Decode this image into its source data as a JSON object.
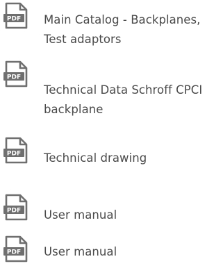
{
  "documents": [
    {
      "label": "Main Catalog - Backplanes, Test adaptors",
      "icon": "pdf-file-icon",
      "icon_text": "PDF"
    },
    {
      "label": "Technical Data Schroff CPCI backplane",
      "icon": "pdf-file-icon",
      "icon_text": "PDF"
    },
    {
      "label": "Technical drawing",
      "icon": "pdf-file-icon",
      "icon_text": "PDF"
    },
    {
      "label": "User manual",
      "icon": "pdf-file-icon",
      "icon_text": "PDF"
    },
    {
      "label": "User manual",
      "icon": "pdf-file-icon",
      "icon_text": "PDF"
    }
  ],
  "colors": {
    "text": "#4a4a4a",
    "icon": "#707070"
  }
}
